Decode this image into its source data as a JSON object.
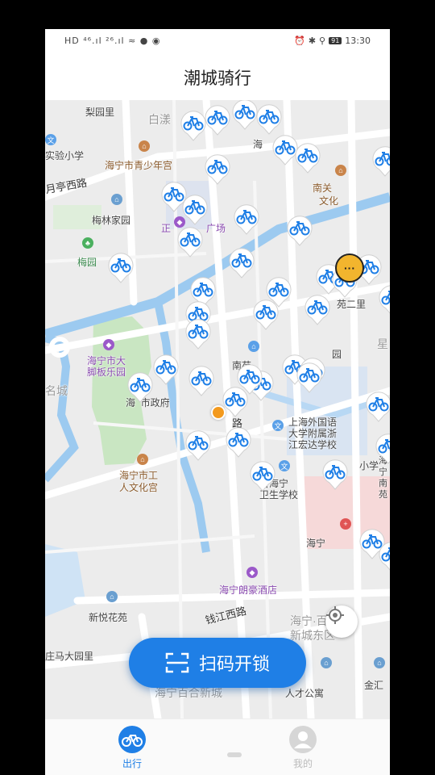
{
  "status_bar": {
    "left": "HD ⁴⁶.ıl ²⁶.ıl ≈ ● ◉",
    "battery": "91",
    "time": "13:30"
  },
  "title": "潮城骑行",
  "map": {
    "labels": {
      "liyuanli": "梨园里",
      "baidang": "白漾",
      "shiyan": "实验小学",
      "yueting": "月亭西路",
      "haining_youth": "海宁市青少年宫",
      "haiyi": "海",
      "meilin": "梅林家园",
      "meiyuan": "梅园",
      "zhengchang": "正",
      "guangchang": "广场",
      "nanguan": "南关",
      "wenhua": "文化",
      "mingcheng": "名城",
      "juban": "海宁市大\n脚板乐园",
      "hai_gov": "海  市政府",
      "nanyuan": "南苑",
      "yuan": "园",
      "er": "苑二里",
      "xing": "星",
      "shanghai_school": "上海外国语\n大学附属浙\n江宏达学校",
      "xiaoxue": "小学",
      "haining_worker": "海宁市工\n人文化宫",
      "sheng_haining": "省海宁\n卫生学校",
      "haining_right": "海宁",
      "langhao": "海宁朗豪酒店",
      "xinyue": "新悦花苑",
      "qianjiang": "钱江西路",
      "baihe": "海宁·百合\n新城东区",
      "zhuangma": "庄马大园里",
      "rencai": "人才公寓",
      "jinhui": "金汇",
      "lu": "路",
      "haining_bottom": "海宁百合新城",
      "hai_far": "海\n宁\n南\n苑"
    },
    "bike_markers": 42,
    "service_bubble": "···"
  },
  "scan_button": {
    "label": "扫码开锁",
    "icon": "scan-icon"
  },
  "tabs": [
    {
      "label": "出行",
      "icon": "bike-icon",
      "active": true
    },
    {
      "label": "我的",
      "icon": "user-icon",
      "active": false
    }
  ],
  "colors": {
    "accent": "#1f7fe6",
    "water": "#9ccaf0",
    "green": "#c9e6c2",
    "road": "#ffffff",
    "marker": "#1f7fe6"
  }
}
